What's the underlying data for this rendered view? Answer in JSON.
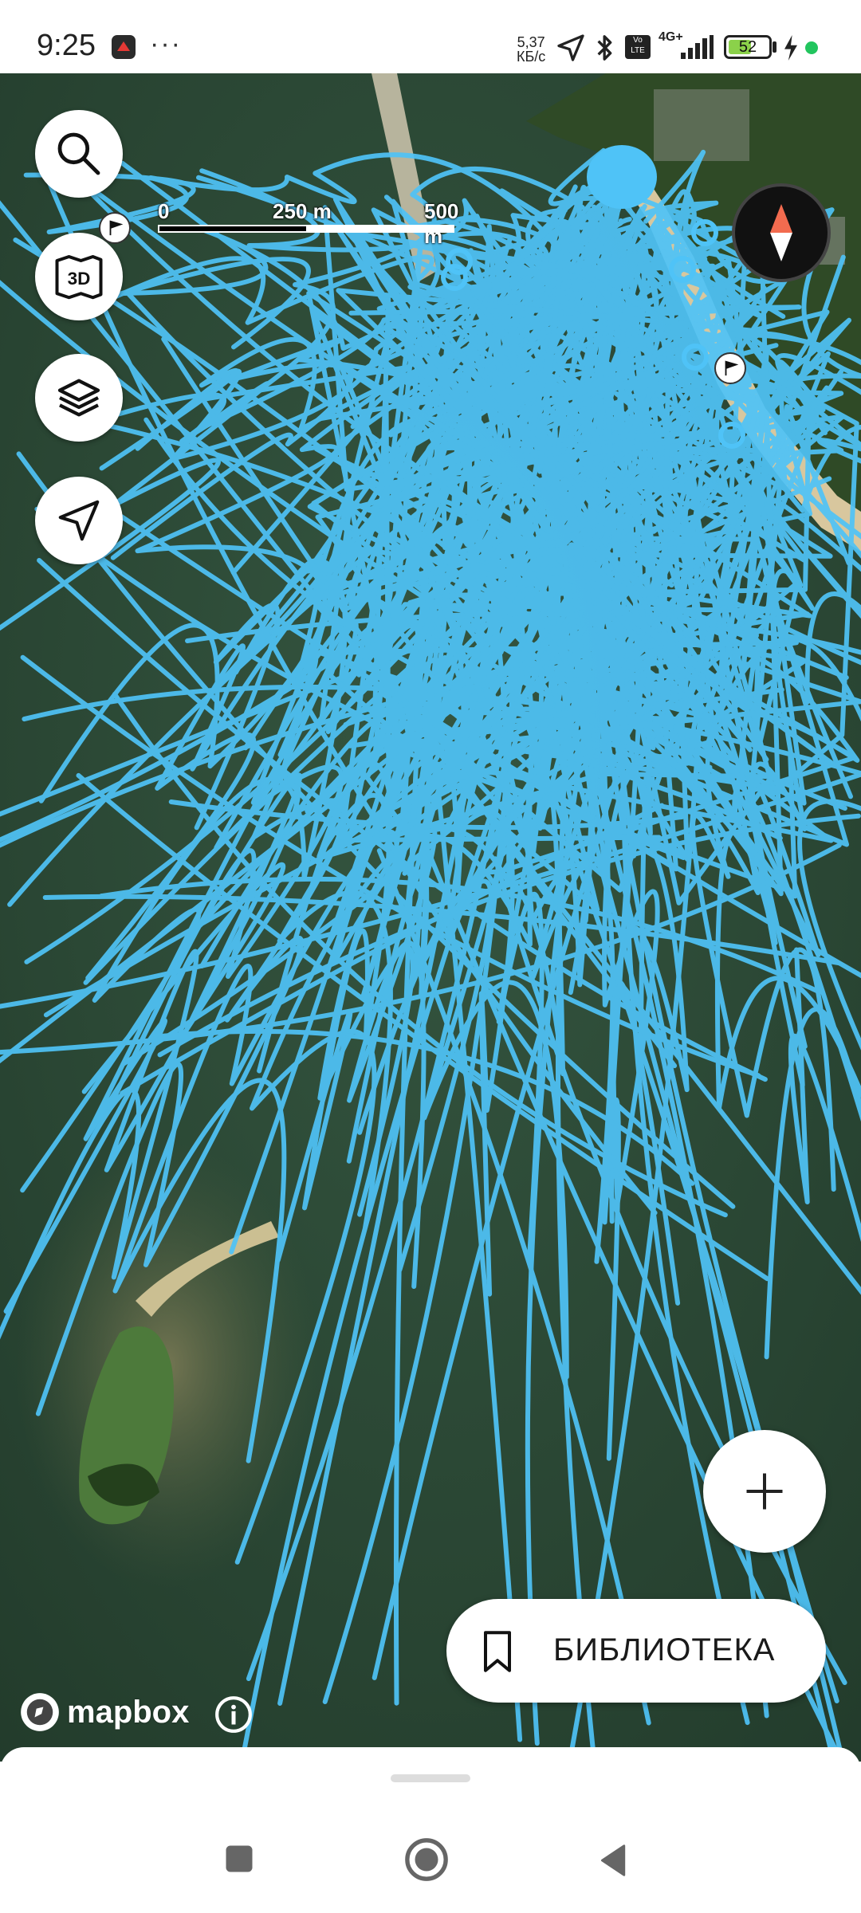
{
  "status_bar": {
    "time": "9:25",
    "more": "···",
    "net_speed_value": "5,37",
    "net_speed_unit": "КБ/с",
    "network": "4G+",
    "battery_level": "52",
    "icons": [
      "app-notification-icon",
      "location-arrow-icon",
      "bluetooth-icon",
      "volte-icon",
      "signal-icon",
      "battery-icon",
      "charging-icon",
      "privacy-dot-icon"
    ]
  },
  "map": {
    "scale": {
      "zero": "0",
      "mid": "250 m",
      "end": "500 m"
    },
    "attribution": "mapbox",
    "track_color": "#4fc3f7",
    "water_color": "#2d4a35"
  },
  "controls": {
    "search": "search-icon",
    "map_3d": {
      "label": "3D"
    },
    "layers": "layers-icon",
    "locate": "navigation-arrow-icon",
    "compass": "compass-icon",
    "add": "plus-icon"
  },
  "library_button": {
    "label": "БИБЛИОТЕКА",
    "icon": "bookmark-icon"
  },
  "nav_bar": [
    "recent-apps-icon",
    "home-icon",
    "back-icon"
  ]
}
